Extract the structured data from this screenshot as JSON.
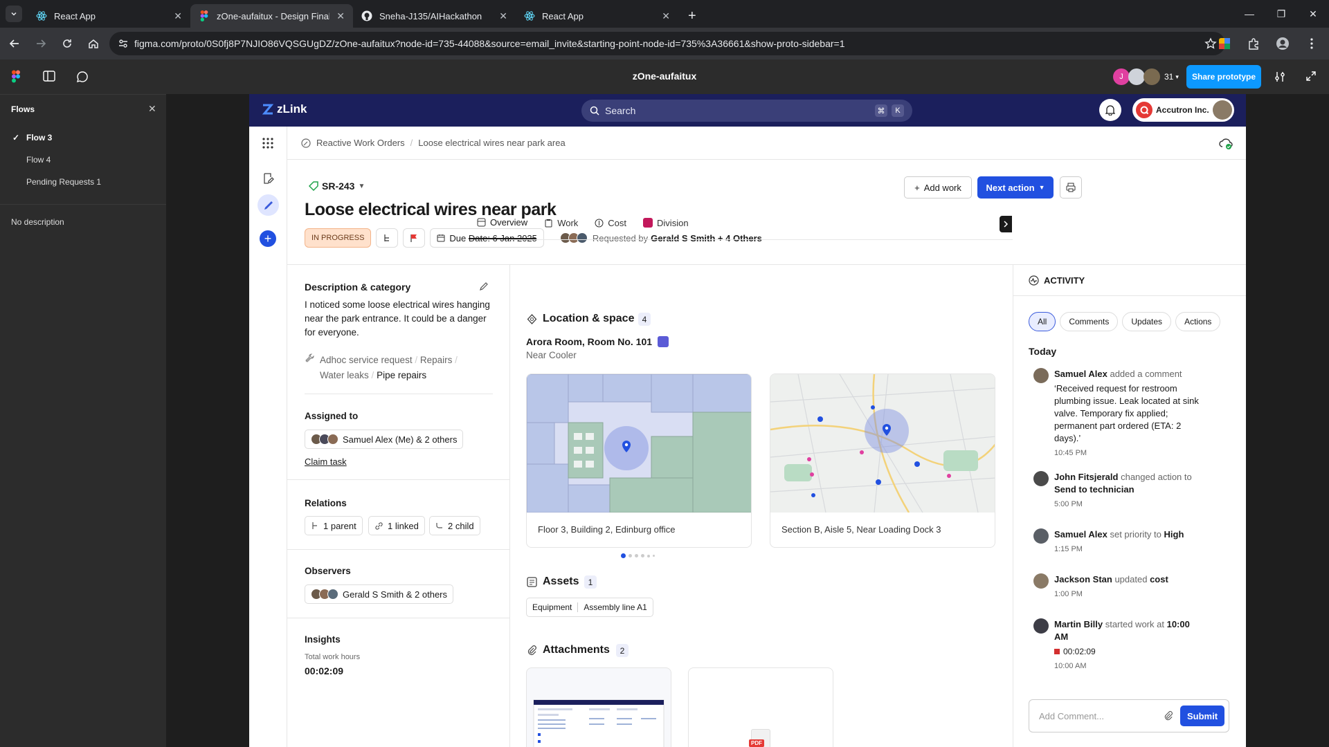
{
  "browser": {
    "tabs": [
      {
        "title": "React App",
        "active": false
      },
      {
        "title": "zOne-aufaitux - Design Final",
        "active": true
      },
      {
        "title": "Sneha-J135/AIHackathon",
        "active": false
      },
      {
        "title": "React App",
        "active": false
      }
    ],
    "url": "figma.com/proto/0S0fj8P7NJIO86VQSGUgDZ/zOne-aufaitux?node-id=735-44088&source=email_invite&starting-point-node-id=735%3A36661&show-proto-sidebar=1"
  },
  "figma": {
    "file_title": "zOne-aufaitux",
    "viewer_count": "31",
    "share_label": "Share prototype",
    "avatar_letter": "J"
  },
  "flows_panel": {
    "title": "Flows",
    "items": [
      {
        "label": "Flow 3",
        "checked": true
      },
      {
        "label": "Flow 4",
        "checked": false
      },
      {
        "label": "Pending Requests 1",
        "checked": false
      }
    ],
    "description": "No description"
  },
  "app": {
    "logo": "zLink",
    "search_placeholder": "Search",
    "search_keys": [
      "⌘",
      "K"
    ],
    "org_name": "Accutron Inc.",
    "breadcrumb": [
      "Reactive Work Orders",
      "Loose electrical wires near park area"
    ],
    "sr_id": "SR-243",
    "title": "Loose electrical wires near park",
    "status": "IN PROGRESS",
    "due_date": "Due Date: 6 Jan 2025",
    "requested_prefix": "Requested by",
    "requested_by": "Gerald S Smith + 4 Others",
    "add_work": "Add work",
    "next_action": "Next action",
    "left": {
      "desc_title": "Description & category",
      "desc_text": "I noticed some loose electrical wires hanging near the park entrance. It could be a danger for everyone.",
      "categories": [
        "Adhoc service request",
        "Repairs",
        "Water leaks",
        "Pipe repairs"
      ],
      "assigned_title": "Assigned to",
      "assigned_text": "Samuel Alex (Me) & 2 others",
      "claim": "Claim task",
      "relations_title": "Relations",
      "relations": [
        "1 parent",
        "1 linked",
        "2 child"
      ],
      "observers_title": "Observers",
      "observers_text": "Gerald S Smith & 2 others",
      "insights_title": "Insights",
      "insights_label": "Total work hours",
      "insights_value": "00:02:09"
    },
    "tabs": [
      "Overview",
      "Work",
      "Cost",
      "Division"
    ],
    "location": {
      "title": "Location & space",
      "count": "4",
      "room": "Arora Room, Room No. 101",
      "sub": "Near Cooler",
      "cards": [
        "Floor 3, Building 2, Edinburg office",
        "Section B, Aisle 5, Near Loading Dock 3"
      ]
    },
    "assets": {
      "title": "Assets",
      "count": "1",
      "tag_a": "Equipment",
      "tag_b": "Assembly line A1"
    },
    "attachments": {
      "title": "Attachments",
      "count": "2",
      "pdf": "PDF"
    },
    "activity": {
      "title": "ACTIVITY",
      "filters": [
        "All",
        "Comments",
        "Updates",
        "Actions"
      ],
      "day": "Today",
      "items": [
        {
          "who": "Samuel Alex",
          "verb": "added a comment",
          "obj": "",
          "text": "‘Received request for restroom plumbing issue. Leak located at sink valve. Temporary fix applied; permanent part ordered (ETA: 2 days).’",
          "time": "10:45 PM"
        },
        {
          "who": "John Fitsjerald",
          "verb": "changed action to",
          "obj": "Send to technician",
          "text": "",
          "time": "5:00 PM"
        },
        {
          "who": "Samuel Alex",
          "verb": "set priority to",
          "obj": "High",
          "text": "",
          "time": "1:15 PM"
        },
        {
          "who": "Jackson Stan",
          "verb": "updated",
          "obj": "cost",
          "text": "",
          "time": "1:00 PM"
        },
        {
          "who": "Martin Billy",
          "verb": "started work at",
          "obj": "10:00 AM",
          "text": "00:02:09",
          "time": "10:00 AM"
        }
      ],
      "comment_placeholder": "Add Comment...",
      "submit": "Submit"
    }
  }
}
